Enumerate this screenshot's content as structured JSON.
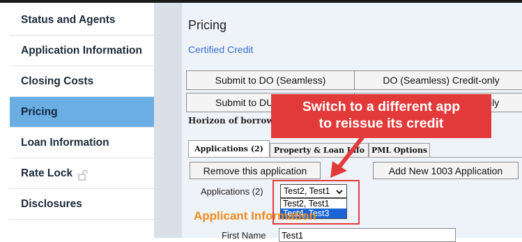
{
  "sidebar": {
    "items": [
      {
        "label": "Status and Agents"
      },
      {
        "label": "Application Information"
      },
      {
        "label": "Closing Costs"
      },
      {
        "label": "Pricing"
      },
      {
        "label": "Loan Information"
      },
      {
        "label": "Rate Lock"
      },
      {
        "label": "Disclosures"
      }
    ],
    "active": "Pricing"
  },
  "main": {
    "title": "Pricing",
    "certified_link": "Certified Credit",
    "buttons": {
      "submit_do": "Submit to DO (Seamless)",
      "do_credit_only": "DO (Seamless) Credit-only",
      "submit_du": "Submit to DU (Seamless)",
      "du_credit_only": "DU (Seamless) Credit-only"
    },
    "horizon_text": "Horizon of borrower interest in property",
    "tabs": [
      "Applications (2)",
      "Property & Loan Info",
      "PML Options"
    ],
    "remove_app_button": "Remove this application",
    "add_app_button": "Add New 1003 Application",
    "applications_label": "Applications (2)",
    "selected_application": "Test2, Test1",
    "dropdown_options": [
      "Test2, Test1",
      "Test4, Test3"
    ],
    "highlighted_option": "Test4, Test3",
    "applicant_section_title": "Applicant Information",
    "first_name_label": "First Name",
    "first_name_value": "Test1"
  },
  "callout": {
    "line1": "Switch to a different app",
    "line2": "to reissue its credit"
  },
  "colors": {
    "sidebar_active": "#6aaee4",
    "callout_red": "#e23a3a",
    "link_blue": "#3a72c9",
    "section_orange": "#f08c1a",
    "option_highlight": "#1a64d6"
  }
}
